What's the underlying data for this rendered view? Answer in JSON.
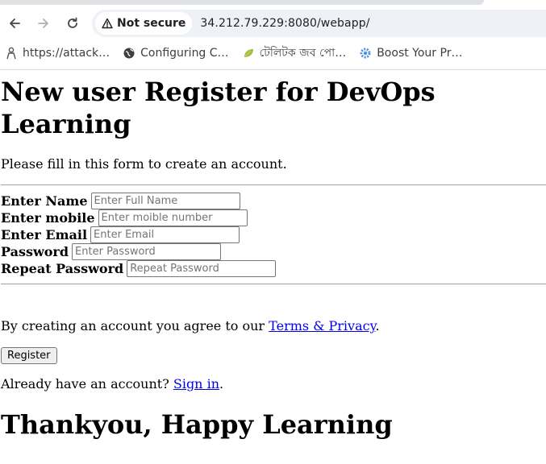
{
  "browser": {
    "security_label": "Not secure",
    "url": "34.212.79.229:8080/webapp/",
    "bookmarks": [
      {
        "label": "https://attack…",
        "icon": "person-icon"
      },
      {
        "label": "Configuring C…",
        "icon": "globe-icon"
      },
      {
        "label": "টেলিটক জব পো…",
        "icon": "leaf-icon"
      },
      {
        "label": "Boost Your Pr…",
        "icon": "gear-icon"
      }
    ]
  },
  "page": {
    "title": "New user Register for DevOps Learning",
    "intro": "Please fill in this form to create an account.",
    "fields": [
      {
        "label": "Enter Name",
        "placeholder": "Enter Full Name"
      },
      {
        "label": "Enter mobile",
        "placeholder": "Enter moible number"
      },
      {
        "label": "Enter Email",
        "placeholder": "Enter Email"
      },
      {
        "label": "Password",
        "placeholder": "Enter Password"
      },
      {
        "label": "Repeat Password",
        "placeholder": "Repeat Password"
      }
    ],
    "agree_text": "By creating an account you agree to our ",
    "terms_link": "Terms & Privacy",
    "agree_end": ".",
    "register_button": "Register",
    "signin_text": "Already have an account? ",
    "signin_link": "Sign in",
    "signin_end": ".",
    "footer_heading": "Thankyou, Happy Learning"
  },
  "colors": {
    "link": "#0000ee",
    "omnibox_bg": "#eef1f6"
  }
}
